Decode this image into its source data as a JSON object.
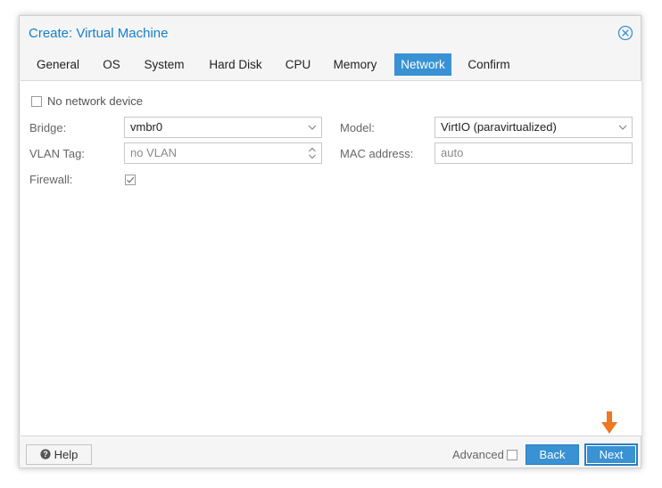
{
  "dialog": {
    "title": "Create: Virtual Machine"
  },
  "tabs": [
    {
      "label": "General"
    },
    {
      "label": "OS"
    },
    {
      "label": "System"
    },
    {
      "label": "Hard Disk"
    },
    {
      "label": "CPU"
    },
    {
      "label": "Memory"
    },
    {
      "label": "Network",
      "active": true
    },
    {
      "label": "Confirm"
    }
  ],
  "form": {
    "no_network_device": {
      "label": "No network device",
      "checked": false
    },
    "bridge": {
      "label": "Bridge:",
      "value": "vmbr0"
    },
    "vlan_tag": {
      "label": "VLAN Tag:",
      "placeholder": "no VLAN"
    },
    "firewall": {
      "label": "Firewall:",
      "checked": true
    },
    "model": {
      "label": "Model:",
      "value": "VirtIO (paravirtualized)"
    },
    "mac_address": {
      "label": "MAC address:",
      "placeholder": "auto"
    }
  },
  "footer": {
    "help_label": "Help",
    "advanced_label": "Advanced",
    "advanced_checked": false,
    "back_label": "Back",
    "next_label": "Next"
  },
  "colors": {
    "accent": "#3892d4",
    "title": "#157fcc",
    "annotation_arrow": "#f07820"
  },
  "icons": {
    "close": "close-circle-icon",
    "help": "question-circle-icon",
    "select_trigger": "chevron-down-icon",
    "spinner": "up-down-arrows-icon",
    "annotation": "arrow-down-icon"
  }
}
